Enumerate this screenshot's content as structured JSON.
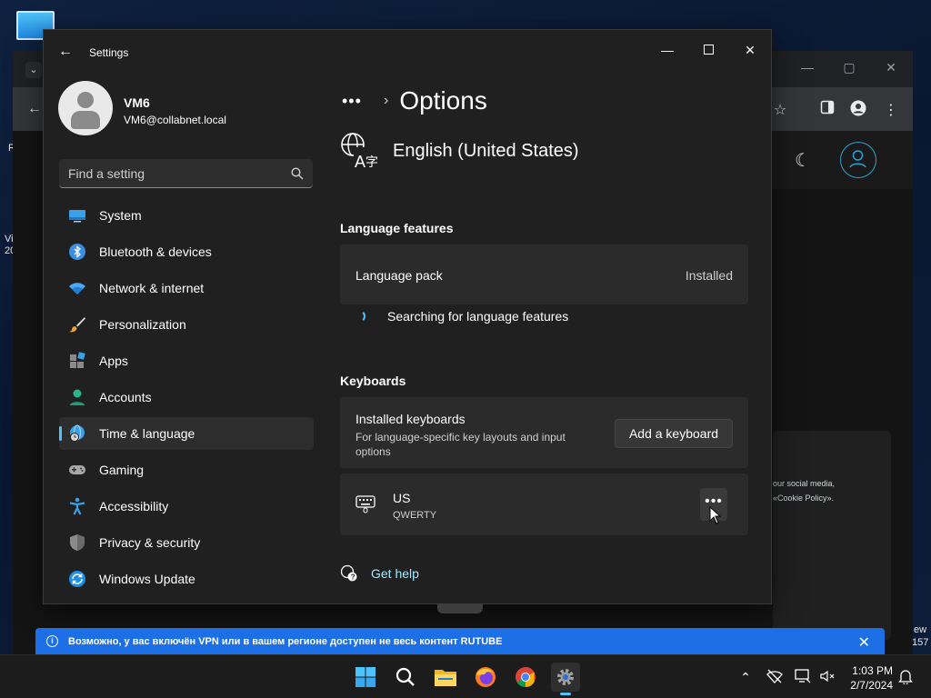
{
  "desktop": {
    "fragments": [
      "R",
      "Vi",
      "20",
      "ew",
      "157"
    ]
  },
  "browser": {
    "cookie_text_1": "our social media,",
    "cookie_text_2": "«Cookie Policy».",
    "window_controls": [
      "—",
      "▢",
      "✕"
    ]
  },
  "settings": {
    "app_title": "Settings",
    "user": {
      "name": "VM6",
      "email": "VM6@collabnet.local"
    },
    "search": {
      "placeholder": "Find a setting"
    },
    "nav": [
      {
        "label": "System",
        "icon": "system-icon"
      },
      {
        "label": "Bluetooth & devices",
        "icon": "bluetooth-icon"
      },
      {
        "label": "Network & internet",
        "icon": "wifi-icon"
      },
      {
        "label": "Personalization",
        "icon": "brush-icon"
      },
      {
        "label": "Apps",
        "icon": "apps-icon"
      },
      {
        "label": "Accounts",
        "icon": "accounts-icon"
      },
      {
        "label": "Time & language",
        "icon": "globe-clock-icon",
        "active": true
      },
      {
        "label": "Gaming",
        "icon": "gamepad-icon"
      },
      {
        "label": "Accessibility",
        "icon": "accessibility-icon"
      },
      {
        "label": "Privacy & security",
        "icon": "shield-icon"
      },
      {
        "label": "Windows Update",
        "icon": "update-icon"
      }
    ],
    "breadcrumb": {
      "more": "•••",
      "title": "Options"
    },
    "language": {
      "name": "English (United States)"
    },
    "language_features": {
      "title": "Language features",
      "pack_label": "Language pack",
      "pack_status": "Installed",
      "searching": "Searching for language features"
    },
    "keyboards": {
      "title": "Keyboards",
      "installed_label": "Installed keyboards",
      "installed_desc": "For language-specific key layouts and input options",
      "add_button": "Add a keyboard",
      "kb_name": "US",
      "kb_layout": "QWERTY",
      "more": "•••"
    },
    "help": {
      "label": "Get help"
    }
  },
  "notification": {
    "text": "Возможно, у вас включён VPN или в вашем регионе доступен не весь контент RUTUBE",
    "close": "✕"
  },
  "taskbar": {
    "time": "1:03 PM",
    "date": "2/7/2024"
  },
  "colors": {
    "accent": "#4cc2ff",
    "window_bg": "#202020",
    "card_bg": "#2b2b2b",
    "notification_bg": "#1d6fe5",
    "link": "#99ebff"
  }
}
